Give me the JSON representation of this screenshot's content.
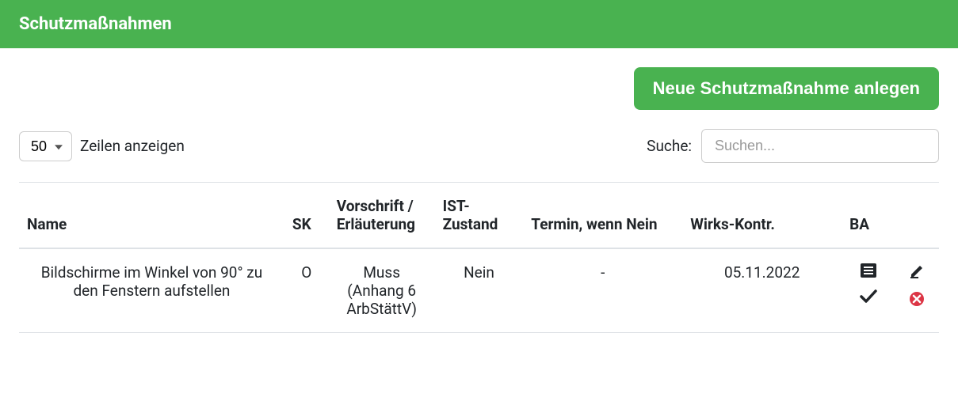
{
  "header": {
    "title": "Schutzmaßnahmen"
  },
  "actions": {
    "new_button": "Neue Schutzmaßnahme anlegen"
  },
  "pagination": {
    "value": "50",
    "rows_label": "Zeilen anzeigen"
  },
  "search": {
    "label": "Suche:",
    "placeholder": "Suchen..."
  },
  "table": {
    "headers": {
      "name": "Name",
      "sk": "SK",
      "vorschrift": "Vorschrift / Erläuterung",
      "ist": "IST-Zustand",
      "termin": "Termin, wenn Nein",
      "wirks": "Wirks-Kontr.",
      "ba": "BA"
    },
    "rows": [
      {
        "name": "Bildschirme im Winkel von 90° zu den Fenstern aufstellen",
        "sk": "O",
        "vorschrift": "Muss (Anhang 6 ArbStättV)",
        "ist": "Nein",
        "termin": "-",
        "wirks": "05.11.2022"
      }
    ]
  }
}
